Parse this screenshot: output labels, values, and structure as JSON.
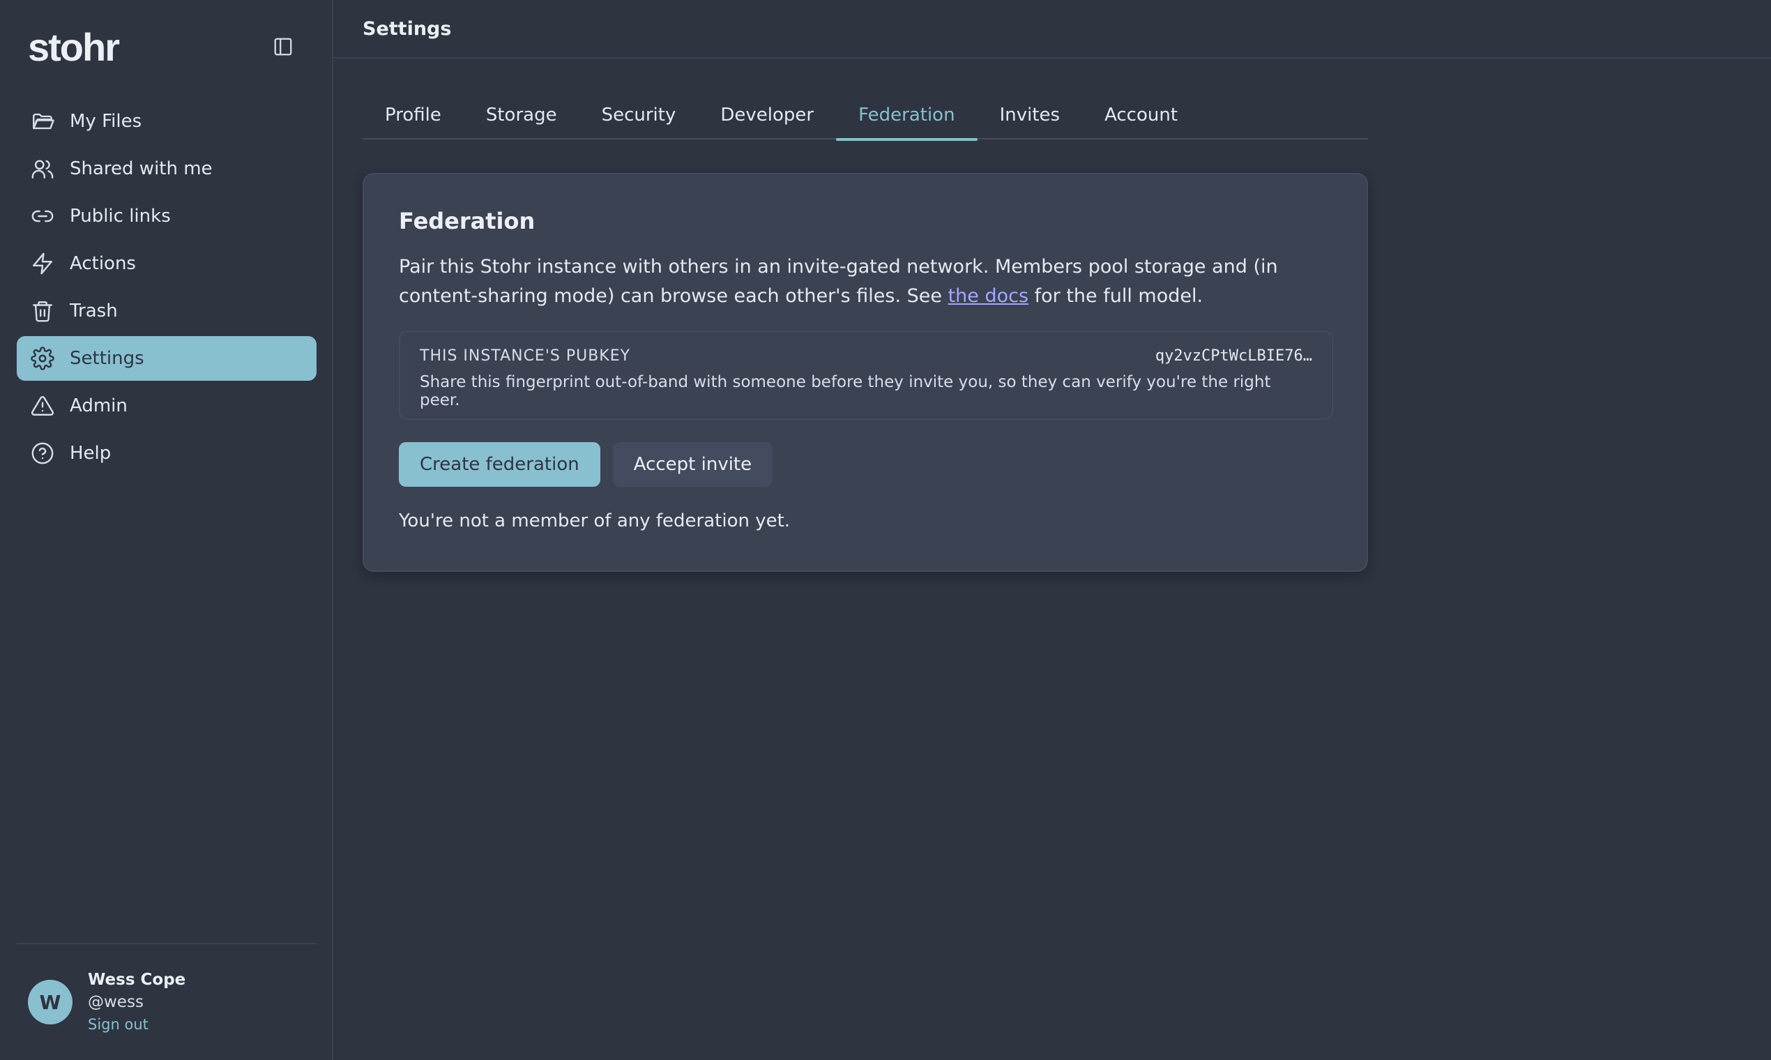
{
  "sidebar": {
    "brand": "stohr",
    "collapse_icon": "sidebar-toggle-icon",
    "items": [
      {
        "label": "My Files",
        "icon": "folder-icon"
      },
      {
        "label": "Shared with me",
        "icon": "users-icon"
      },
      {
        "label": "Public links",
        "icon": "link-icon"
      },
      {
        "label": "Actions",
        "icon": "lightning-icon"
      },
      {
        "label": "Trash",
        "icon": "trash-icon"
      },
      {
        "label": "Settings",
        "icon": "gear-icon",
        "active": true
      },
      {
        "label": "Admin",
        "icon": "warning-icon"
      },
      {
        "label": "Help",
        "icon": "help-icon"
      }
    ],
    "user": {
      "initial": "W",
      "name": "Wess Cope",
      "handle": "@wess",
      "signout": "Sign out"
    }
  },
  "header": {
    "title": "Settings"
  },
  "tabs": [
    {
      "label": "Profile"
    },
    {
      "label": "Storage"
    },
    {
      "label": "Security"
    },
    {
      "label": "Developer"
    },
    {
      "label": "Federation",
      "active": true
    },
    {
      "label": "Invites"
    },
    {
      "label": "Account"
    }
  ],
  "federation": {
    "title": "Federation",
    "desc_before": "Pair this Stohr instance with others in an invite-gated network. Members pool storage and (in content-sharing mode) can browse each other's files. See ",
    "docs_link": "the docs",
    "desc_after": " for the full model.",
    "pubkey_label": "THIS INSTANCE'S PUBKEY",
    "pubkey_value": "qy2vzCPtWcLBIE76…",
    "pubkey_help": "Share this fingerprint out-of-band with someone before they invite you, so they can verify you're the right peer.",
    "create_button": "Create federation",
    "accept_button": "Accept invite",
    "empty_message": "You're not a member of any federation yet."
  },
  "colors": {
    "background": "#2e3440",
    "card": "#3b4252",
    "accent": "#88c0d0",
    "link": "#a3a8ff"
  }
}
